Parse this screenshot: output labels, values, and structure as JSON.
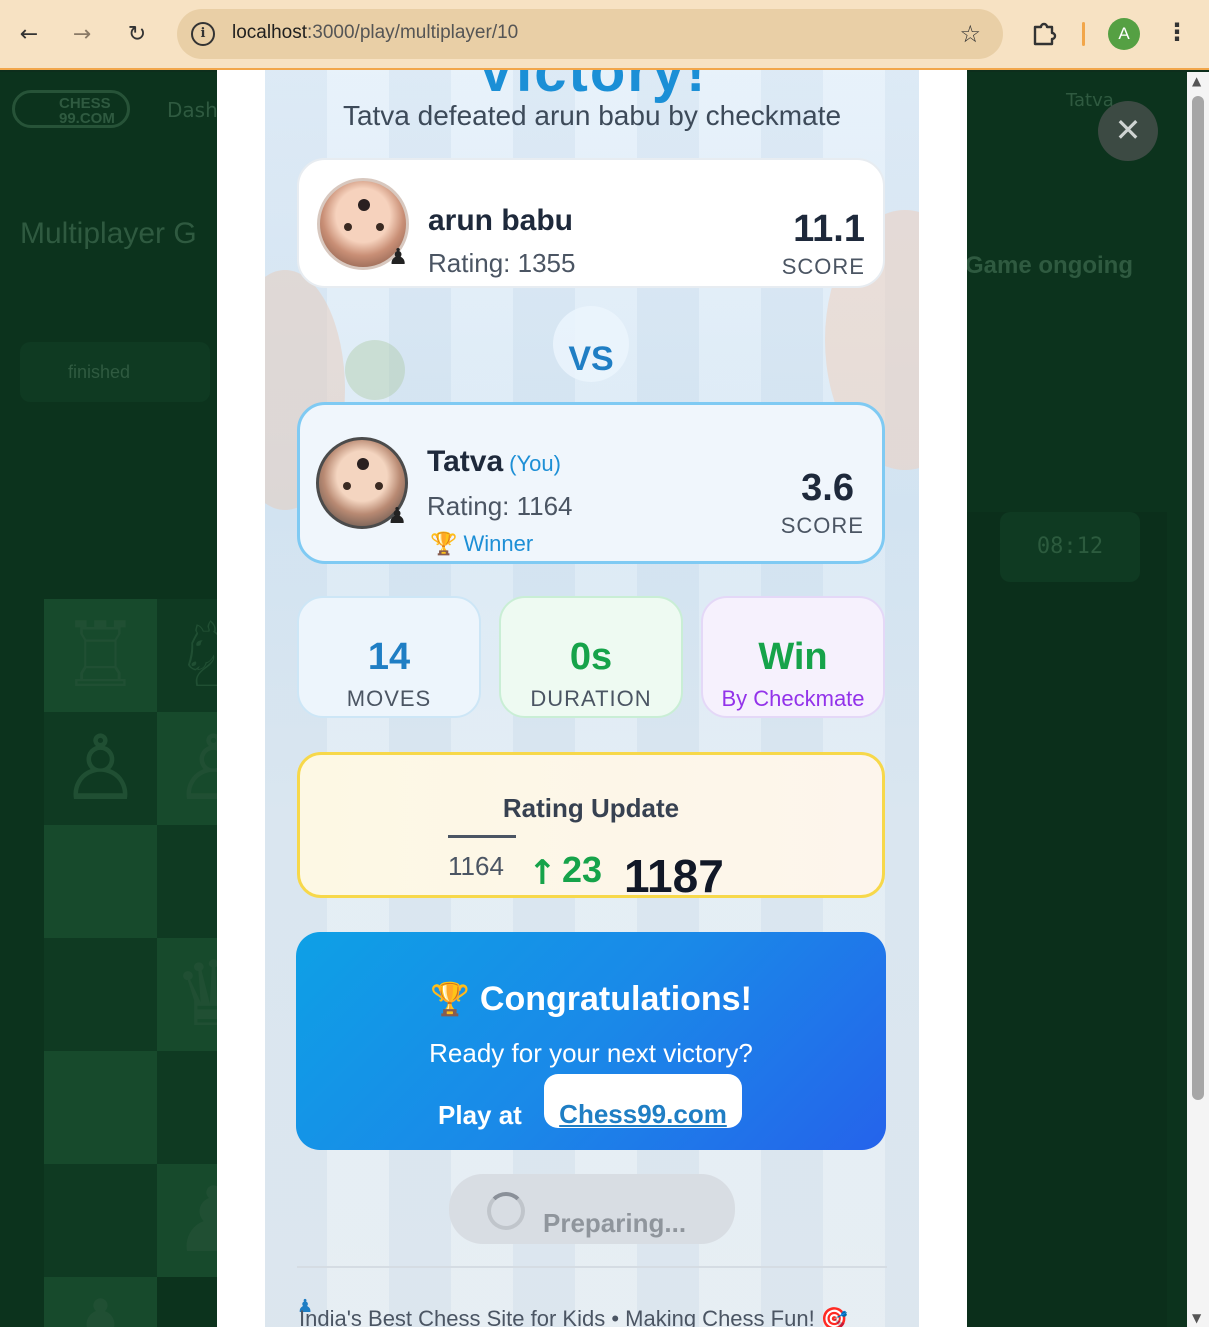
{
  "browser": {
    "url_host": "localhost",
    "url_path": ":3000/play/multiplayer/10",
    "profile_initial": "A",
    "icons": [
      "back-icon",
      "forward-icon",
      "reload-icon",
      "site-info-icon",
      "star-icon",
      "extensions-icon",
      "menu-icon"
    ]
  },
  "background": {
    "logo": "CHESS 99.COM",
    "nav_item": "Dash",
    "user": "Tatva",
    "title": "Multiplayer G",
    "status": "Game ongoing",
    "chip": "finished",
    "timer": "08:12"
  },
  "modal": {
    "heading": "Victory!",
    "subtitle": "Tatva defeated arun babu by checkmate",
    "opponent": {
      "name": "arun babu",
      "rating": "Rating: 1355",
      "score": "11.1",
      "score_label": "SCORE"
    },
    "vs": "VS",
    "player": {
      "name": "Tatva",
      "you_tag": "(You)",
      "rating": "Rating: 1164",
      "winner": "Winner",
      "score": "3.6",
      "score_label": "SCORE"
    },
    "stats": {
      "moves_value": "14",
      "moves_label": "MOVES",
      "duration_value": "0s",
      "duration_label": "DURATION",
      "result_value": "Win",
      "result_label": "By Checkmate"
    },
    "rating_update": {
      "title": "Rating Update",
      "old": "1164",
      "delta": "23",
      "new": "1187"
    },
    "congrats": {
      "title": "Congratulations!",
      "subtitle": "Ready for your next victory?",
      "play_at": "Play at",
      "link": "Chess99.com"
    },
    "preparing": "Preparing...",
    "footer": "India's Best Chess Site for Kids • Making Chess Fun! 🎯"
  },
  "colors": {
    "accent": "#1f7ec4",
    "success": "#16a34a",
    "purple": "#9333ea",
    "chrome": "#f7e2c3"
  }
}
